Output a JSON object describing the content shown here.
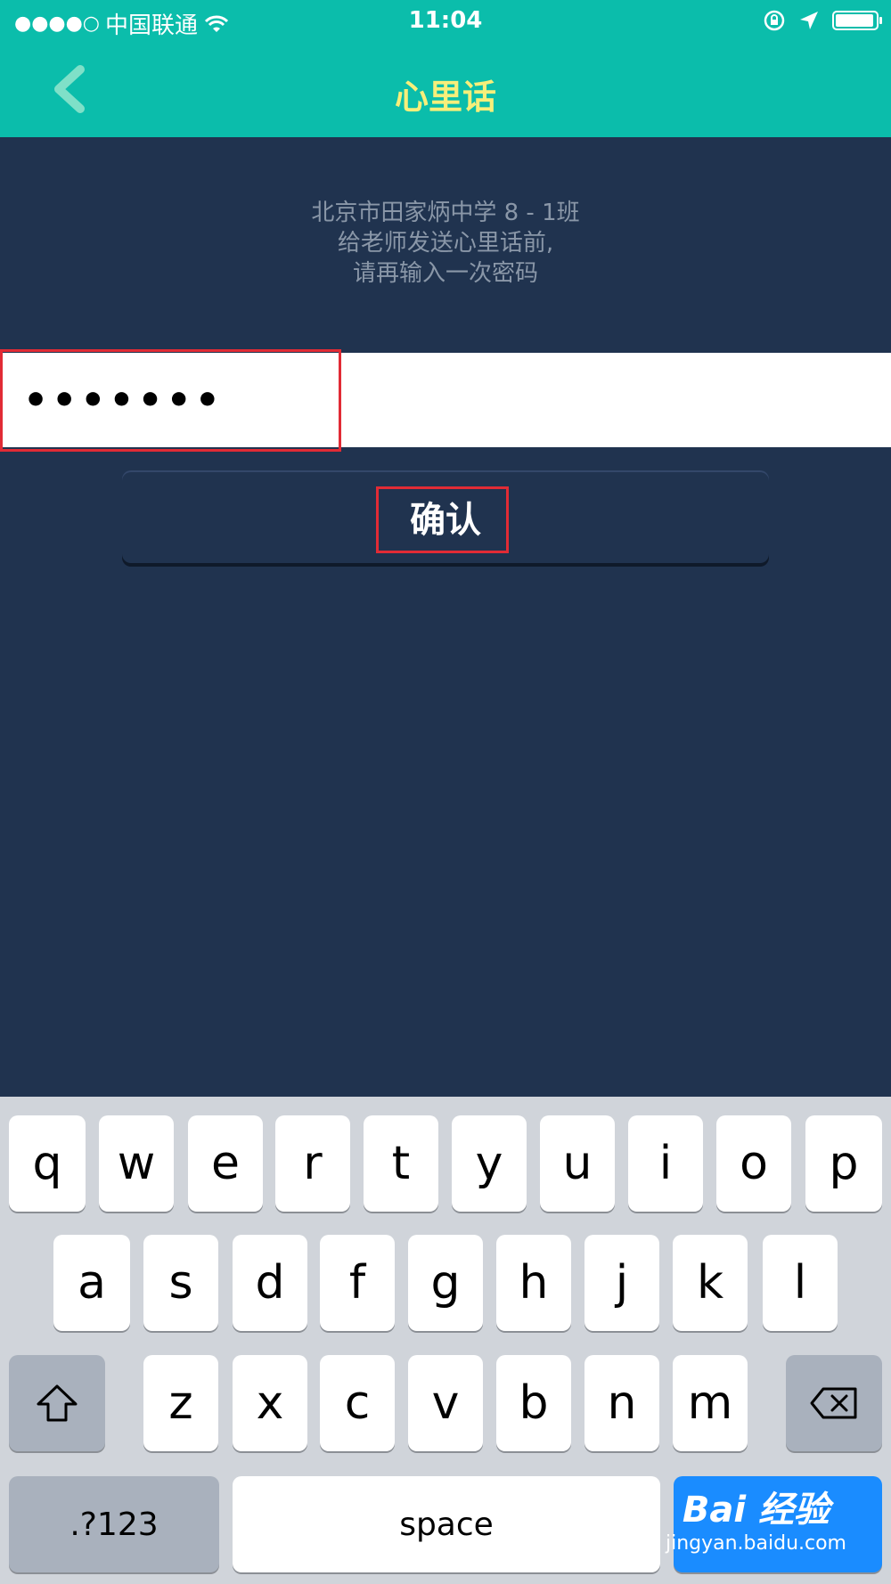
{
  "status_bar": {
    "signal": "●●●●○",
    "carrier": "中国联通",
    "time": "11:04",
    "battery_level": 0.95
  },
  "nav": {
    "back_icon": "chevron-left-icon",
    "title": "心里话",
    "title_color": "#f7ef7a",
    "bar_color": "#0bbdab"
  },
  "prompt": {
    "line1": "北京市田家炳中学 8 - 1班",
    "line2": "给老师发送心里话前,",
    "line3": "请再输入一次密码"
  },
  "password": {
    "value": "•••••••"
  },
  "confirm": {
    "label": "确认"
  },
  "keyboard": {
    "row1": [
      "q",
      "w",
      "e",
      "r",
      "t",
      "y",
      "u",
      "i",
      "o",
      "p"
    ],
    "row2": [
      "a",
      "s",
      "d",
      "f",
      "g",
      "h",
      "j",
      "k",
      "l"
    ],
    "row3": [
      "z",
      "x",
      "c",
      "v",
      "b",
      "n",
      "m"
    ],
    "shift_icon": "shift-icon",
    "delete_icon": "backspace-icon",
    "numbers_label": ".?123",
    "space_label": "space"
  },
  "watermark": {
    "top": "Bai 经验",
    "bottom": "jingyan.baidu.com"
  }
}
